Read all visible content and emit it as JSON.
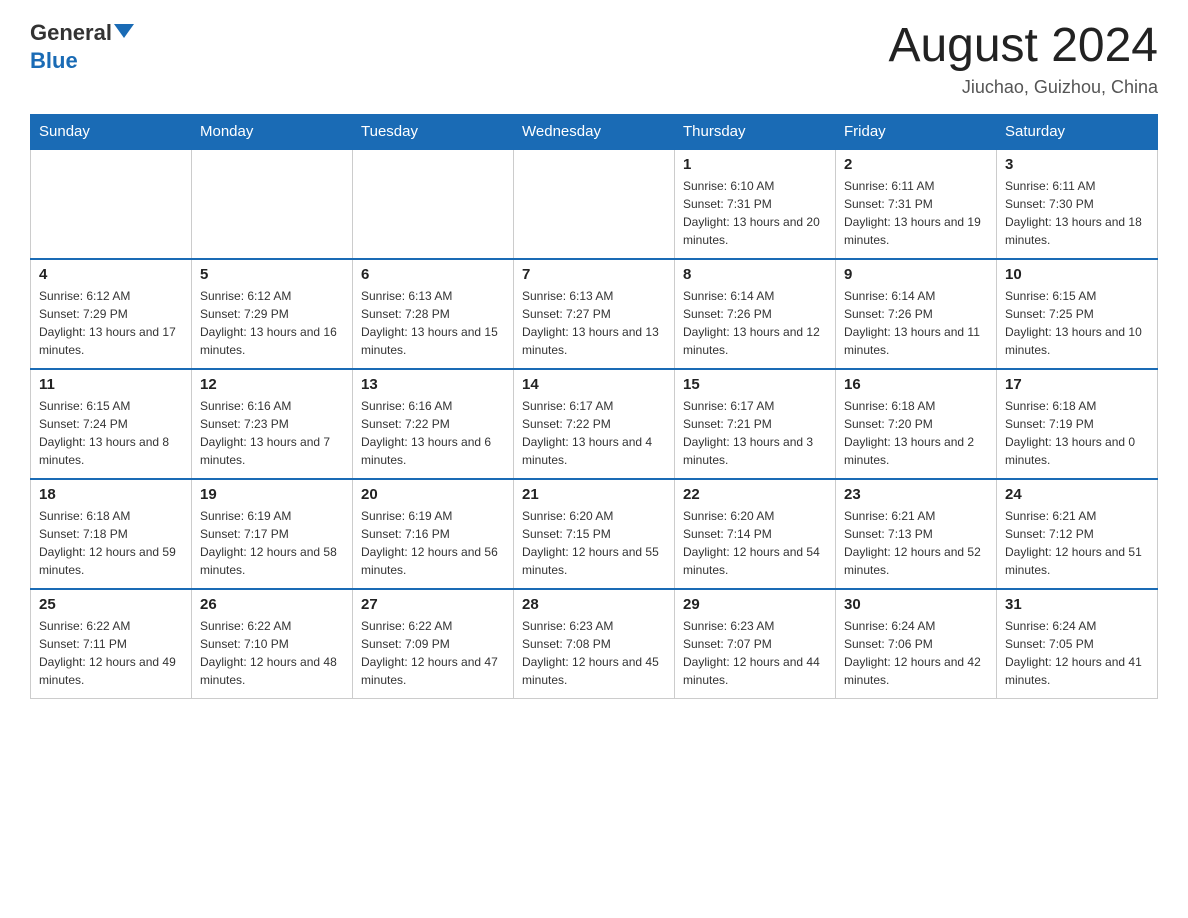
{
  "logo": {
    "general": "General",
    "blue": "Blue"
  },
  "title": "August 2024",
  "location": "Jiuchao, Guizhou, China",
  "days_of_week": [
    "Sunday",
    "Monday",
    "Tuesday",
    "Wednesday",
    "Thursday",
    "Friday",
    "Saturday"
  ],
  "weeks": [
    [
      {
        "day": "",
        "info": ""
      },
      {
        "day": "",
        "info": ""
      },
      {
        "day": "",
        "info": ""
      },
      {
        "day": "",
        "info": ""
      },
      {
        "day": "1",
        "info": "Sunrise: 6:10 AM\nSunset: 7:31 PM\nDaylight: 13 hours and 20 minutes."
      },
      {
        "day": "2",
        "info": "Sunrise: 6:11 AM\nSunset: 7:31 PM\nDaylight: 13 hours and 19 minutes."
      },
      {
        "day": "3",
        "info": "Sunrise: 6:11 AM\nSunset: 7:30 PM\nDaylight: 13 hours and 18 minutes."
      }
    ],
    [
      {
        "day": "4",
        "info": "Sunrise: 6:12 AM\nSunset: 7:29 PM\nDaylight: 13 hours and 17 minutes."
      },
      {
        "day": "5",
        "info": "Sunrise: 6:12 AM\nSunset: 7:29 PM\nDaylight: 13 hours and 16 minutes."
      },
      {
        "day": "6",
        "info": "Sunrise: 6:13 AM\nSunset: 7:28 PM\nDaylight: 13 hours and 15 minutes."
      },
      {
        "day": "7",
        "info": "Sunrise: 6:13 AM\nSunset: 7:27 PM\nDaylight: 13 hours and 13 minutes."
      },
      {
        "day": "8",
        "info": "Sunrise: 6:14 AM\nSunset: 7:26 PM\nDaylight: 13 hours and 12 minutes."
      },
      {
        "day": "9",
        "info": "Sunrise: 6:14 AM\nSunset: 7:26 PM\nDaylight: 13 hours and 11 minutes."
      },
      {
        "day": "10",
        "info": "Sunrise: 6:15 AM\nSunset: 7:25 PM\nDaylight: 13 hours and 10 minutes."
      }
    ],
    [
      {
        "day": "11",
        "info": "Sunrise: 6:15 AM\nSunset: 7:24 PM\nDaylight: 13 hours and 8 minutes."
      },
      {
        "day": "12",
        "info": "Sunrise: 6:16 AM\nSunset: 7:23 PM\nDaylight: 13 hours and 7 minutes."
      },
      {
        "day": "13",
        "info": "Sunrise: 6:16 AM\nSunset: 7:22 PM\nDaylight: 13 hours and 6 minutes."
      },
      {
        "day": "14",
        "info": "Sunrise: 6:17 AM\nSunset: 7:22 PM\nDaylight: 13 hours and 4 minutes."
      },
      {
        "day": "15",
        "info": "Sunrise: 6:17 AM\nSunset: 7:21 PM\nDaylight: 13 hours and 3 minutes."
      },
      {
        "day": "16",
        "info": "Sunrise: 6:18 AM\nSunset: 7:20 PM\nDaylight: 13 hours and 2 minutes."
      },
      {
        "day": "17",
        "info": "Sunrise: 6:18 AM\nSunset: 7:19 PM\nDaylight: 13 hours and 0 minutes."
      }
    ],
    [
      {
        "day": "18",
        "info": "Sunrise: 6:18 AM\nSunset: 7:18 PM\nDaylight: 12 hours and 59 minutes."
      },
      {
        "day": "19",
        "info": "Sunrise: 6:19 AM\nSunset: 7:17 PM\nDaylight: 12 hours and 58 minutes."
      },
      {
        "day": "20",
        "info": "Sunrise: 6:19 AM\nSunset: 7:16 PM\nDaylight: 12 hours and 56 minutes."
      },
      {
        "day": "21",
        "info": "Sunrise: 6:20 AM\nSunset: 7:15 PM\nDaylight: 12 hours and 55 minutes."
      },
      {
        "day": "22",
        "info": "Sunrise: 6:20 AM\nSunset: 7:14 PM\nDaylight: 12 hours and 54 minutes."
      },
      {
        "day": "23",
        "info": "Sunrise: 6:21 AM\nSunset: 7:13 PM\nDaylight: 12 hours and 52 minutes."
      },
      {
        "day": "24",
        "info": "Sunrise: 6:21 AM\nSunset: 7:12 PM\nDaylight: 12 hours and 51 minutes."
      }
    ],
    [
      {
        "day": "25",
        "info": "Sunrise: 6:22 AM\nSunset: 7:11 PM\nDaylight: 12 hours and 49 minutes."
      },
      {
        "day": "26",
        "info": "Sunrise: 6:22 AM\nSunset: 7:10 PM\nDaylight: 12 hours and 48 minutes."
      },
      {
        "day": "27",
        "info": "Sunrise: 6:22 AM\nSunset: 7:09 PM\nDaylight: 12 hours and 47 minutes."
      },
      {
        "day": "28",
        "info": "Sunrise: 6:23 AM\nSunset: 7:08 PM\nDaylight: 12 hours and 45 minutes."
      },
      {
        "day": "29",
        "info": "Sunrise: 6:23 AM\nSunset: 7:07 PM\nDaylight: 12 hours and 44 minutes."
      },
      {
        "day": "30",
        "info": "Sunrise: 6:24 AM\nSunset: 7:06 PM\nDaylight: 12 hours and 42 minutes."
      },
      {
        "day": "31",
        "info": "Sunrise: 6:24 AM\nSunset: 7:05 PM\nDaylight: 12 hours and 41 minutes."
      }
    ]
  ]
}
